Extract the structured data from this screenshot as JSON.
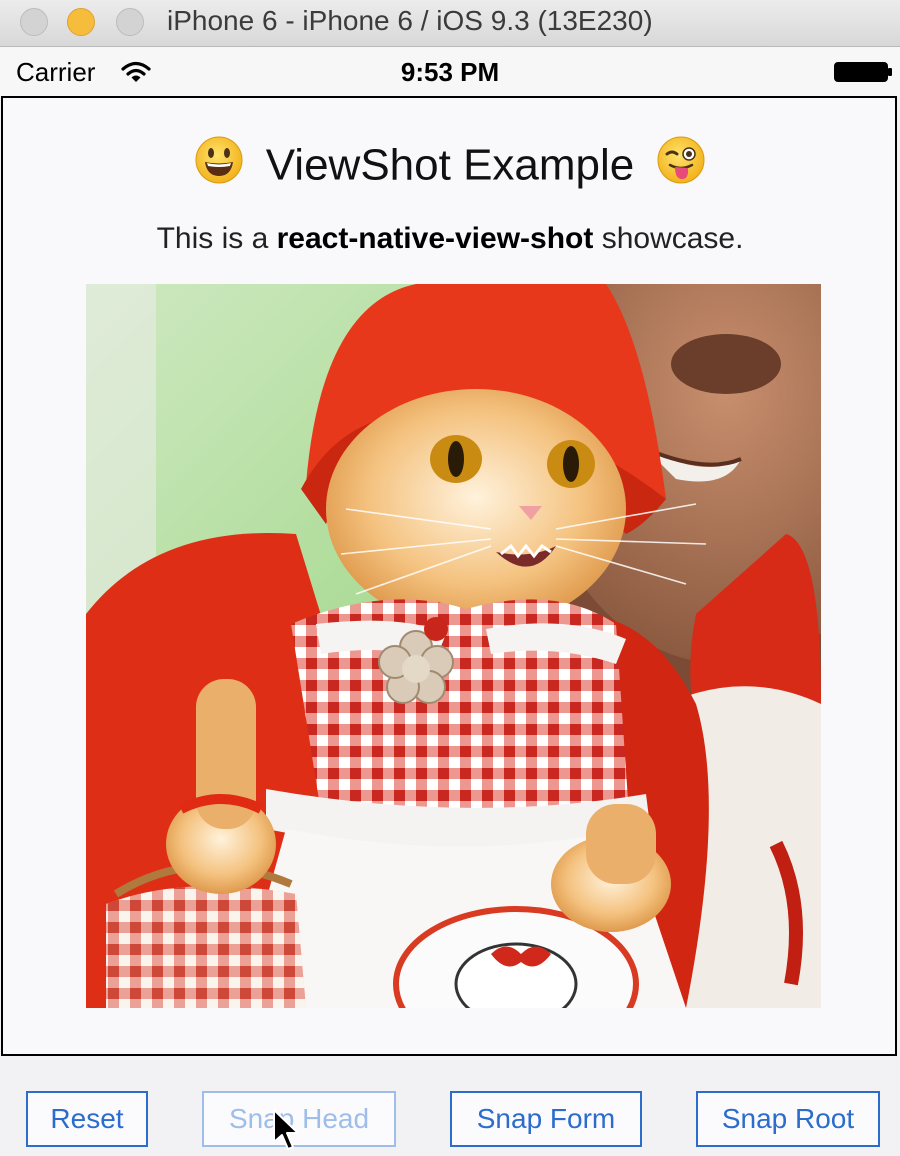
{
  "window": {
    "title": "iPhone 6 - iPhone 6 / iOS 9.3 (13E230)"
  },
  "status_bar": {
    "carrier": "Carrier",
    "time": "9:53 PM"
  },
  "app": {
    "heading": "ViewShot Example",
    "heading_emoji_left": "😃",
    "heading_emoji_right": "😜",
    "subtitle_prefix": "This is a ",
    "subtitle_bold": "react-native-view-shot",
    "subtitle_suffix": " showcase."
  },
  "buttons": [
    {
      "label": "Reset",
      "enabled": true
    },
    {
      "label": "Snap Head",
      "enabled": false
    },
    {
      "label": "Snap Form",
      "enabled": true
    },
    {
      "label": "Snap Root",
      "enabled": true
    }
  ],
  "colors": {
    "accent": "#2b6ccc",
    "accent_disabled": "#9fbde9",
    "traffic_yellow": "#f6bd3c"
  }
}
